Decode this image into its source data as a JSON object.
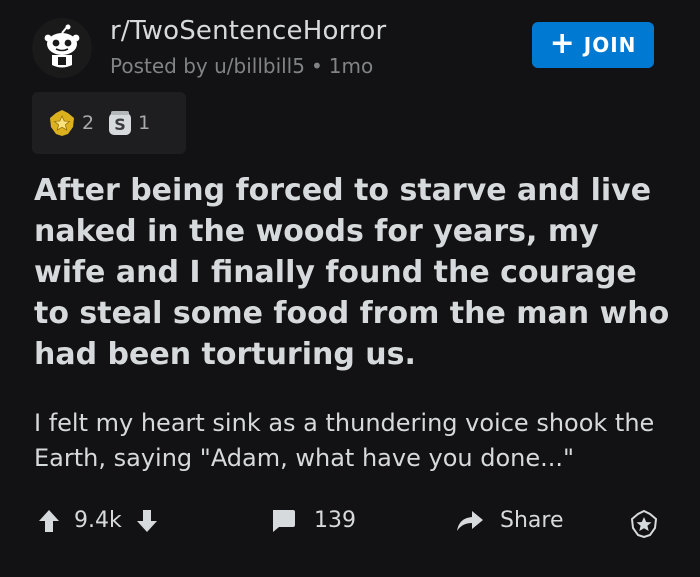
{
  "post": {
    "subreddit": "r/TwoSentenceHorror",
    "posted_by": "Posted by u/billbill5",
    "age": "1mo",
    "join_label": "JOIN",
    "awards": [
      {
        "icon": "gold-award-icon",
        "count": "2"
      },
      {
        "icon": "silver-award-icon",
        "count": "1"
      }
    ],
    "title": "After being forced to starve and live naked in the woods for years, my wife and I finally found the courage to steal some food from the man who had been torturing us.",
    "body": "I felt my heart sink as a thundering voice shook the Earth, saying \"Adam, what have you done...\""
  },
  "actions": {
    "vote_count": "9.4k",
    "comment_count": "139",
    "share_label": "Share"
  },
  "colors": {
    "background": "#121214",
    "accent": "#0079d3",
    "text": "#d7dadc",
    "muted": "#818384"
  }
}
